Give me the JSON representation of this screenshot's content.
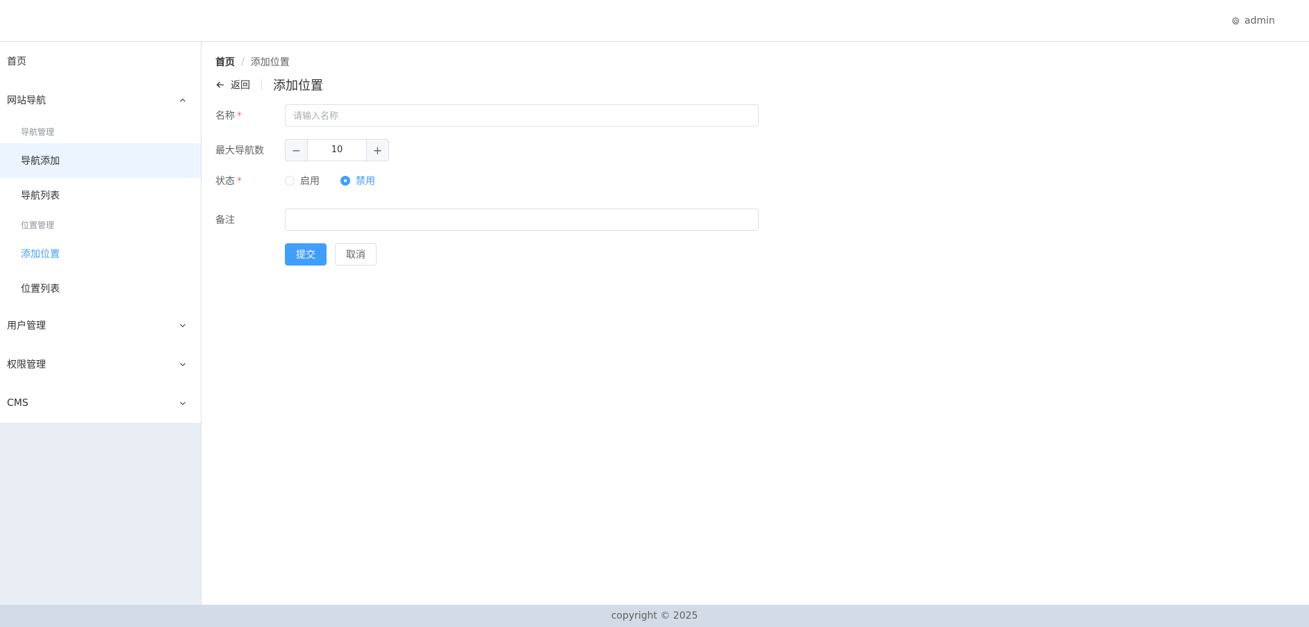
{
  "header": {
    "username": "admin",
    "user_icon": "gear-icon"
  },
  "sidebar": {
    "home": "首页",
    "site_nav": {
      "label": "网站导航",
      "icon": "chevron-up-icon"
    },
    "nav_group": "导航管理",
    "nav_add": "导航添加",
    "nav_list": "导航列表",
    "pos_group": "位置管理",
    "pos_add": "添加位置",
    "pos_list": "位置列表",
    "user_mgmt": {
      "label": "用户管理",
      "icon": "chevron-down-icon"
    },
    "perm_mgmt": {
      "label": "权限管理",
      "icon": "chevron-down-icon"
    },
    "cms": {
      "label": "CMS",
      "icon": "chevron-down-icon"
    }
  },
  "breadcrumb": {
    "home": "首页",
    "separator": "/",
    "current": "添加位置"
  },
  "page_header": {
    "back": "返回",
    "title": "添加位置"
  },
  "form": {
    "name": {
      "label": "名称",
      "required": "*",
      "placeholder": "请输入名称",
      "value": ""
    },
    "max_nav": {
      "label": "最大导航数",
      "value": "10",
      "minus": "−",
      "plus": "+"
    },
    "status": {
      "label": "状态",
      "required": "*",
      "options": [
        "启用",
        "禁用"
      ],
      "selected": "禁用"
    },
    "remark": {
      "label": "备注",
      "value": ""
    },
    "submit": "提交",
    "cancel": "取消"
  },
  "footer": {
    "copyright": "copyright © 2025"
  },
  "colors": {
    "accent": "#409eff",
    "required": "#f56c6c",
    "sidebar_bg": "#e9eef5",
    "footer_bg": "#d3dce6"
  }
}
